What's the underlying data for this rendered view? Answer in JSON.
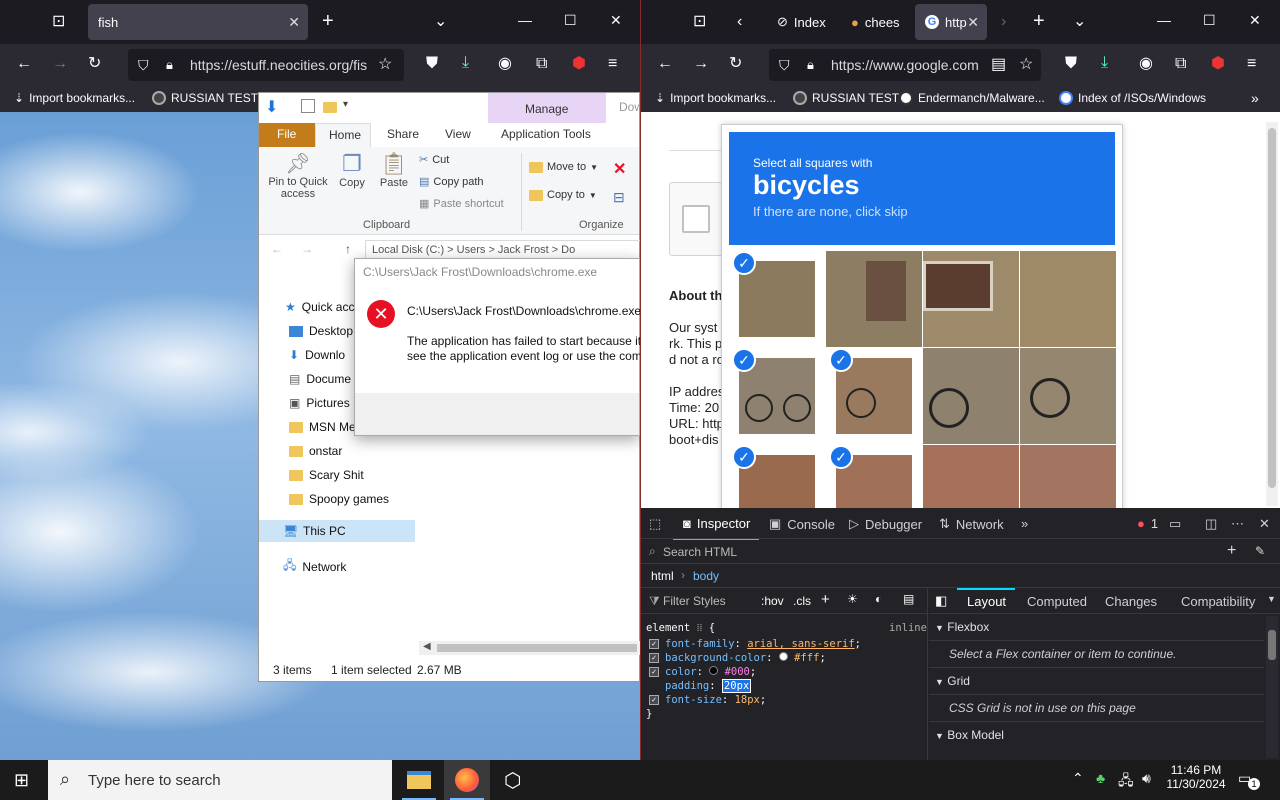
{
  "left_browser": {
    "tab_title": "fish",
    "url": "https://estuff.neocities.org/fis",
    "bookmarks": [
      "Import bookmarks...",
      "RUSSIAN TEST"
    ]
  },
  "explorer": {
    "manage_label": "Manage",
    "tabs": [
      "File",
      "Home",
      "Share",
      "View",
      "Application Tools"
    ],
    "dow_label": "Dow",
    "ribbon": {
      "pin": "Pin to Quick access",
      "copy": "Copy",
      "paste": "Paste",
      "cut": "Cut",
      "copy_path": "Copy path",
      "paste_shortcut": "Paste shortcut",
      "move_to": "Move to",
      "copy_to": "Copy to",
      "clipboard_group": "Clipboard",
      "organize_group": "Organize"
    },
    "address_hint": "Local Disk (C:) > Users > Jack Frost > Do",
    "nav_items": [
      "Quick acc",
      "Desktop",
      "Downlo",
      "Docume",
      "Pictures",
      "MSN Me",
      "onstar",
      "Scary Shit",
      "Spoopy games"
    ],
    "this_pc": "This PC",
    "network": "Network",
    "status": {
      "items": "3 items",
      "selected": "1 item selected",
      "size": "2.67 MB"
    }
  },
  "error_dialog": {
    "title": "C:\\Users\\Jack Frost\\Downloads\\chrome.exe",
    "path": "C:\\Users\\Jack Frost\\Downloads\\chrome.exe",
    "message_line1": "The application has failed to start because its",
    "message_line2": "see the application event log or use the comm"
  },
  "right_browser": {
    "tabs": [
      "Index",
      "chees",
      "http"
    ],
    "url": "https://www.google.com",
    "bookmarks": [
      "Import bookmarks...",
      "RUSSIAN TEST",
      "Endermanch/Malware...",
      "Index of /ISOs/Windows"
    ]
  },
  "captcha": {
    "line1": "Select all squares with",
    "keyword": "bicycles",
    "line2": "If there are none, click skip"
  },
  "page_text": {
    "about": "About th",
    "our_syst": "Our syst",
    "rk": "rk. This p",
    "not_a": "d not a ro",
    "ip": "IP addres",
    "time": "Time: 20",
    "url": "URL: http",
    "boot": "boot+dis"
  },
  "devtools": {
    "tabs": [
      "Inspector",
      "Console",
      "Debugger",
      "Network"
    ],
    "error_count": "1",
    "search_placeholder": "Search HTML",
    "crumbs": [
      "html",
      "body"
    ],
    "filter_placeholder": "Filter Styles",
    "hov": ":hov",
    "cls": ".cls",
    "panel_tabs": [
      "Layout",
      "Computed",
      "Changes",
      "Compatibility"
    ],
    "element_rule": "element",
    "inline_label": "inline",
    "props": [
      {
        "name": "font-family",
        "value": "arial, sans-serif"
      },
      {
        "name": "background-color",
        "value": "#fff"
      },
      {
        "name": "color",
        "value": "#000"
      },
      {
        "name": "padding",
        "value": "20px"
      },
      {
        "name": "font-size",
        "value": "18px"
      }
    ],
    "flexbox_h": "Flexbox",
    "flexbox_b": "Select a Flex container or item to continue.",
    "grid_h": "Grid",
    "grid_b": "CSS Grid is not in use on this page",
    "box_h": "Box Model"
  },
  "taskbar": {
    "search_placeholder": "Type here to search",
    "time": "11:46 PM",
    "date": "11/30/2024",
    "notif_count": "1"
  }
}
